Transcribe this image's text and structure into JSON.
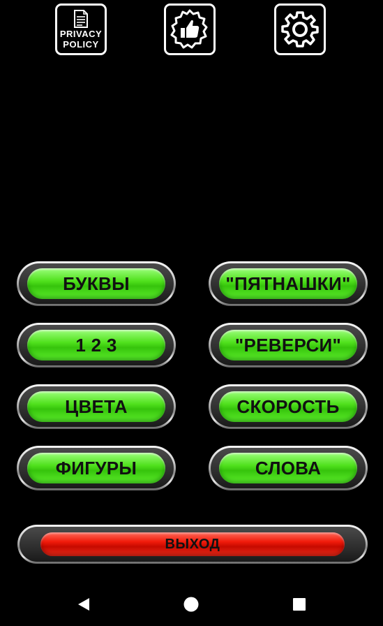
{
  "top_bar": {
    "privacy": {
      "icon": "document-icon",
      "line1": "PRIVACY",
      "line2": "POLICY"
    },
    "rate": {
      "icon": "thumbs-up-badge-icon"
    },
    "settings": {
      "icon": "gear-icon"
    }
  },
  "menu": {
    "letters": "БУКВЫ",
    "fifteen": "\"ПЯТНАШКИ\"",
    "numbers": "1 2 3",
    "reversi": "\"РЕВЕРСИ\"",
    "colors": "ЦВЕТА",
    "speed": "СКОРОСТЬ",
    "shapes": "ФИГУРЫ",
    "words": "СЛОВА"
  },
  "exit": {
    "label": "ВЫХОД"
  },
  "nav_bar": {
    "back": "triangle-back-icon",
    "home": "circle-home-icon",
    "recents": "square-recents-icon"
  },
  "colors": {
    "background": "#000000",
    "pill_green": "#4fe01c",
    "exit_red": "#f01a0a",
    "chrome": "#c8c8c8"
  }
}
